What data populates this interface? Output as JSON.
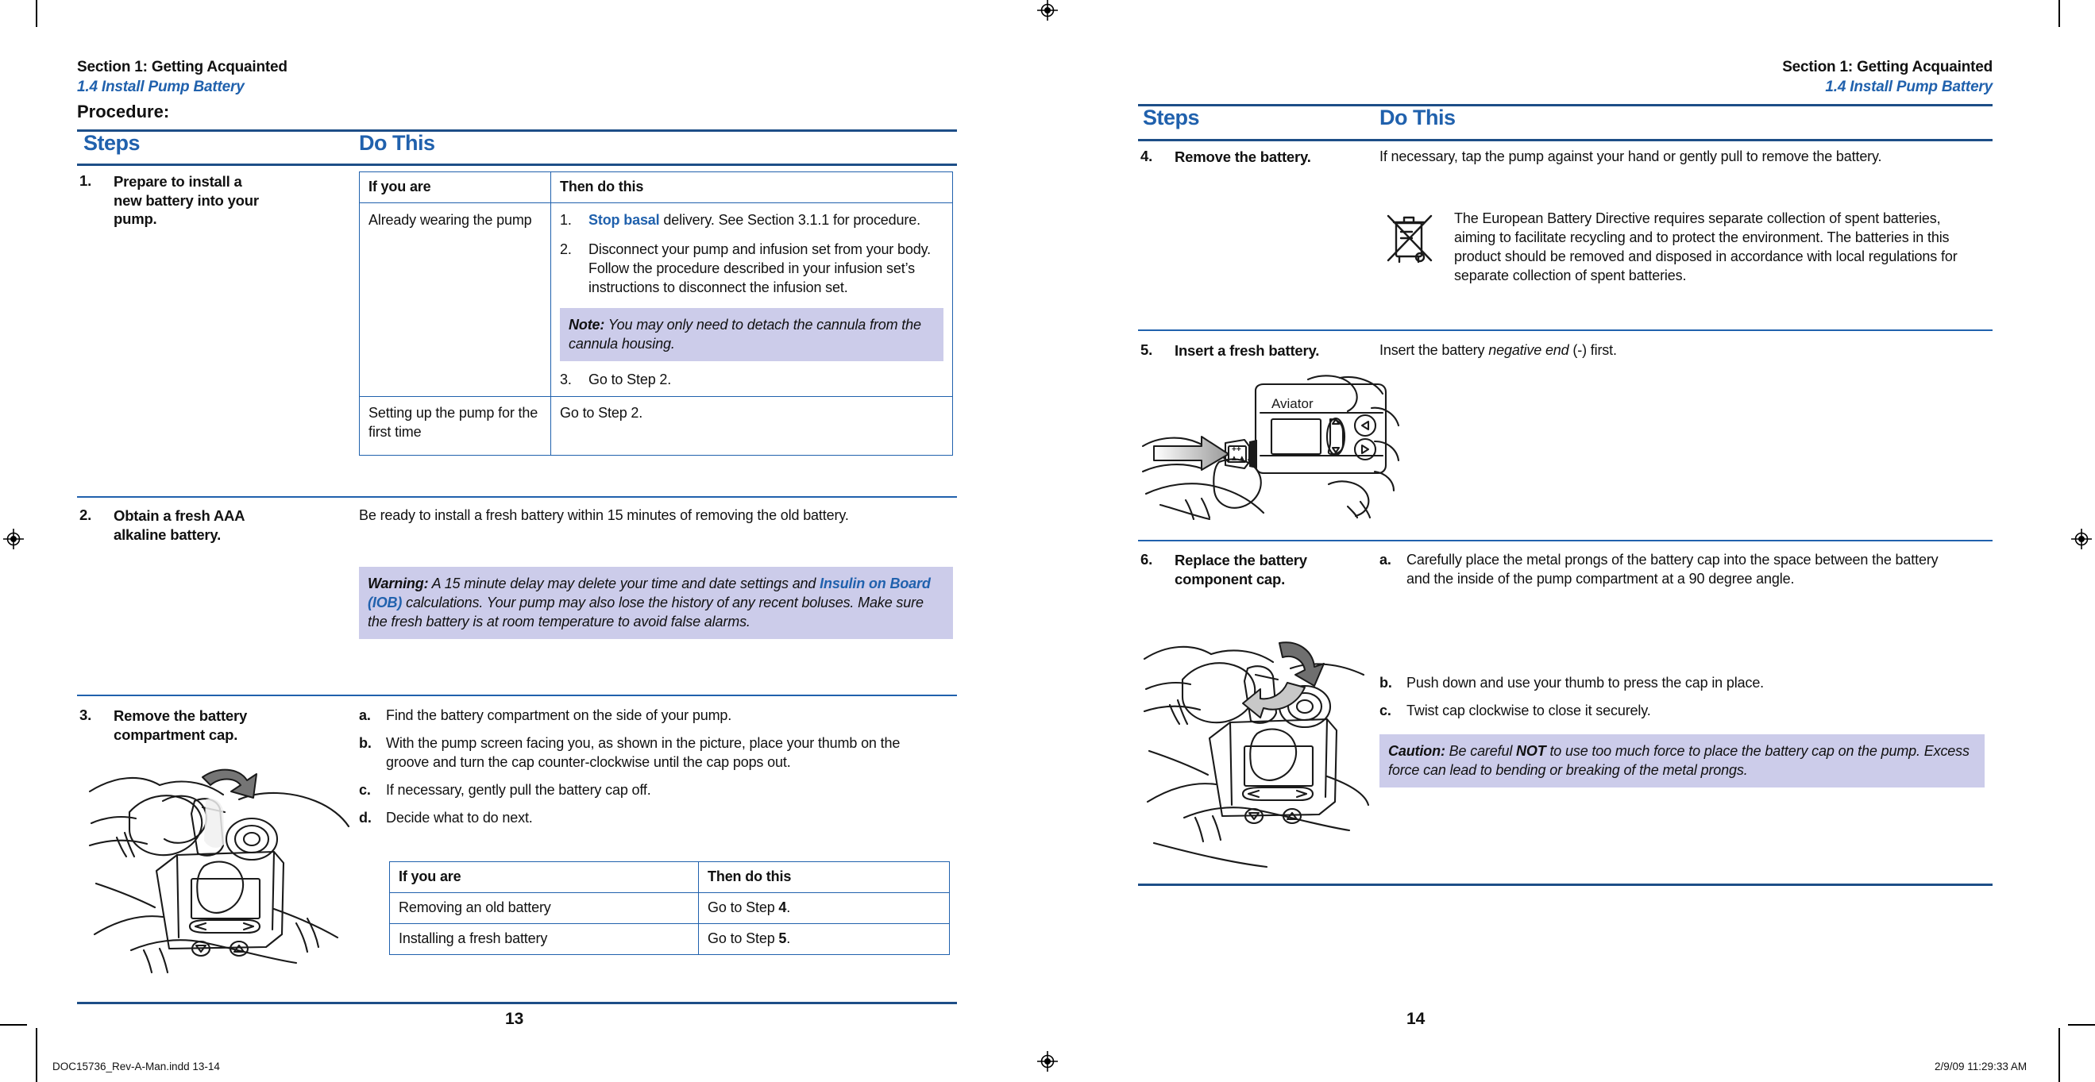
{
  "document": {
    "header": {
      "section": "Section 1: Getting Acquainted",
      "subsection": "1.4 Install Pump Battery"
    },
    "procedure_label": "Procedure:",
    "columns": {
      "steps": "Steps",
      "do_this": "Do This"
    }
  },
  "left_page": {
    "page_number": "13",
    "steps": [
      {
        "number": "1.",
        "title": "Prepare to install a new battery into your pump.",
        "table": {
          "headers": [
            "If you are",
            "Then do this"
          ],
          "rows": [
            {
              "condition": "Already wearing the pump",
              "items": [
                {
                  "marker": "1.",
                  "link": "Stop basal",
                  "text": " delivery. See Section 3.1.1 for procedure."
                },
                {
                  "marker": "2.",
                  "link": "",
                  "text": "Disconnect your pump and infusion set from your body. Follow the procedure described in your infusion set’s instructions to disconnect the infusion set."
                }
              ],
              "note": {
                "label": "Note:",
                "text": " You may only need to detach the cannula from the cannula housing."
              },
              "items_after": [
                {
                  "marker": "3.",
                  "link": "",
                  "text": "Go to Step 2."
                }
              ]
            },
            {
              "condition": "Setting up the pump for the first time",
              "plain": "Go to Step 2."
            }
          ]
        }
      },
      {
        "number": "2.",
        "title": "Obtain a fresh AAA alkaline battery.",
        "body": "Be ready to install a fresh battery within 15 minutes of removing the old battery.",
        "warning": {
          "label": "Warning:",
          "part1": " A 15 minute delay may delete your time and date settings and ",
          "keyword": "Insulin on Board (IOB)",
          "part2": " calculations. Your pump may also lose the history of any recent boluses. Make sure the fresh battery is at room temperature to avoid false alarms."
        }
      },
      {
        "number": "3.",
        "title": "Remove the battery compartment cap.",
        "figure_name": "pump-cap-removal-illustration",
        "sublist": [
          {
            "marker": "a.",
            "text": "Find the battery compartment on the side of your pump."
          },
          {
            "marker": "b.",
            "text": "With the pump screen facing you, as shown in the picture, place your thumb on the groove and turn the cap counter-clockwise until the cap pops out."
          },
          {
            "marker": "c.",
            "text": "If necessary, gently pull the battery cap off."
          },
          {
            "marker": "d.",
            "text": "Decide what to do next."
          }
        ],
        "table": {
          "headers": [
            "If you are",
            "Then do this"
          ],
          "rows": [
            {
              "condition": "Removing an old battery",
              "prefix": "Go to Step ",
              "bold": "4",
              "suffix": "."
            },
            {
              "condition": "Installing a fresh battery",
              "prefix": "Go to Step ",
              "bold": "5",
              "suffix": "."
            }
          ]
        }
      }
    ]
  },
  "right_page": {
    "page_number": "14",
    "steps": [
      {
        "number": "4.",
        "title": "Remove the battery.",
        "body": "If necessary, tap the pump against your hand or gently pull to remove the battery.",
        "directive": {
          "icon_name": "crossed-out-wheelie-bin-icon",
          "text": "The European Battery Directive requires separate collection of spent batteries, aiming to facilitate recycling and to protect the environment.  The batteries in this product should be removed and disposed in accordance with local regulations for separate collection of spent batteries."
        }
      },
      {
        "number": "5.",
        "title": "Insert a fresh battery.",
        "body_prefix": "Insert the battery ",
        "body_italic": "negative end",
        "body_suffix": " (-) first.",
        "figure_name": "insert-battery-illustration",
        "figure_device_label": "Aviator"
      },
      {
        "number": "6.",
        "title": "Replace the battery component cap.",
        "figure_name": "replace-cap-illustration",
        "sublist": [
          {
            "marker": "a.",
            "text": "Carefully place the metal prongs of the battery cap into the space between the battery and the inside of the pump compartment at a 90 degree angle."
          },
          {
            "marker": "b.",
            "text": "Push down and use your thumb to press the cap in place."
          },
          {
            "marker": "c.",
            "text": "Twist cap clockwise to close it securely."
          }
        ],
        "caution": {
          "label": "Caution:",
          "part1": " Be careful ",
          "keyword": "NOT",
          "part2": " to use too much force to place the battery cap on the pump. Excess force can lead to bending or breaking of the metal prongs."
        }
      }
    ]
  },
  "print_marks": {
    "filename": "DOC15736_Rev-A-Man.indd   13-14",
    "timestamp": "2/9/09   11:29:33 AM"
  },
  "colors": {
    "accent_blue": "#2061ad",
    "callout_bg": "#ccccea",
    "rule_blue": "#1d4e87",
    "text": "#111111"
  }
}
